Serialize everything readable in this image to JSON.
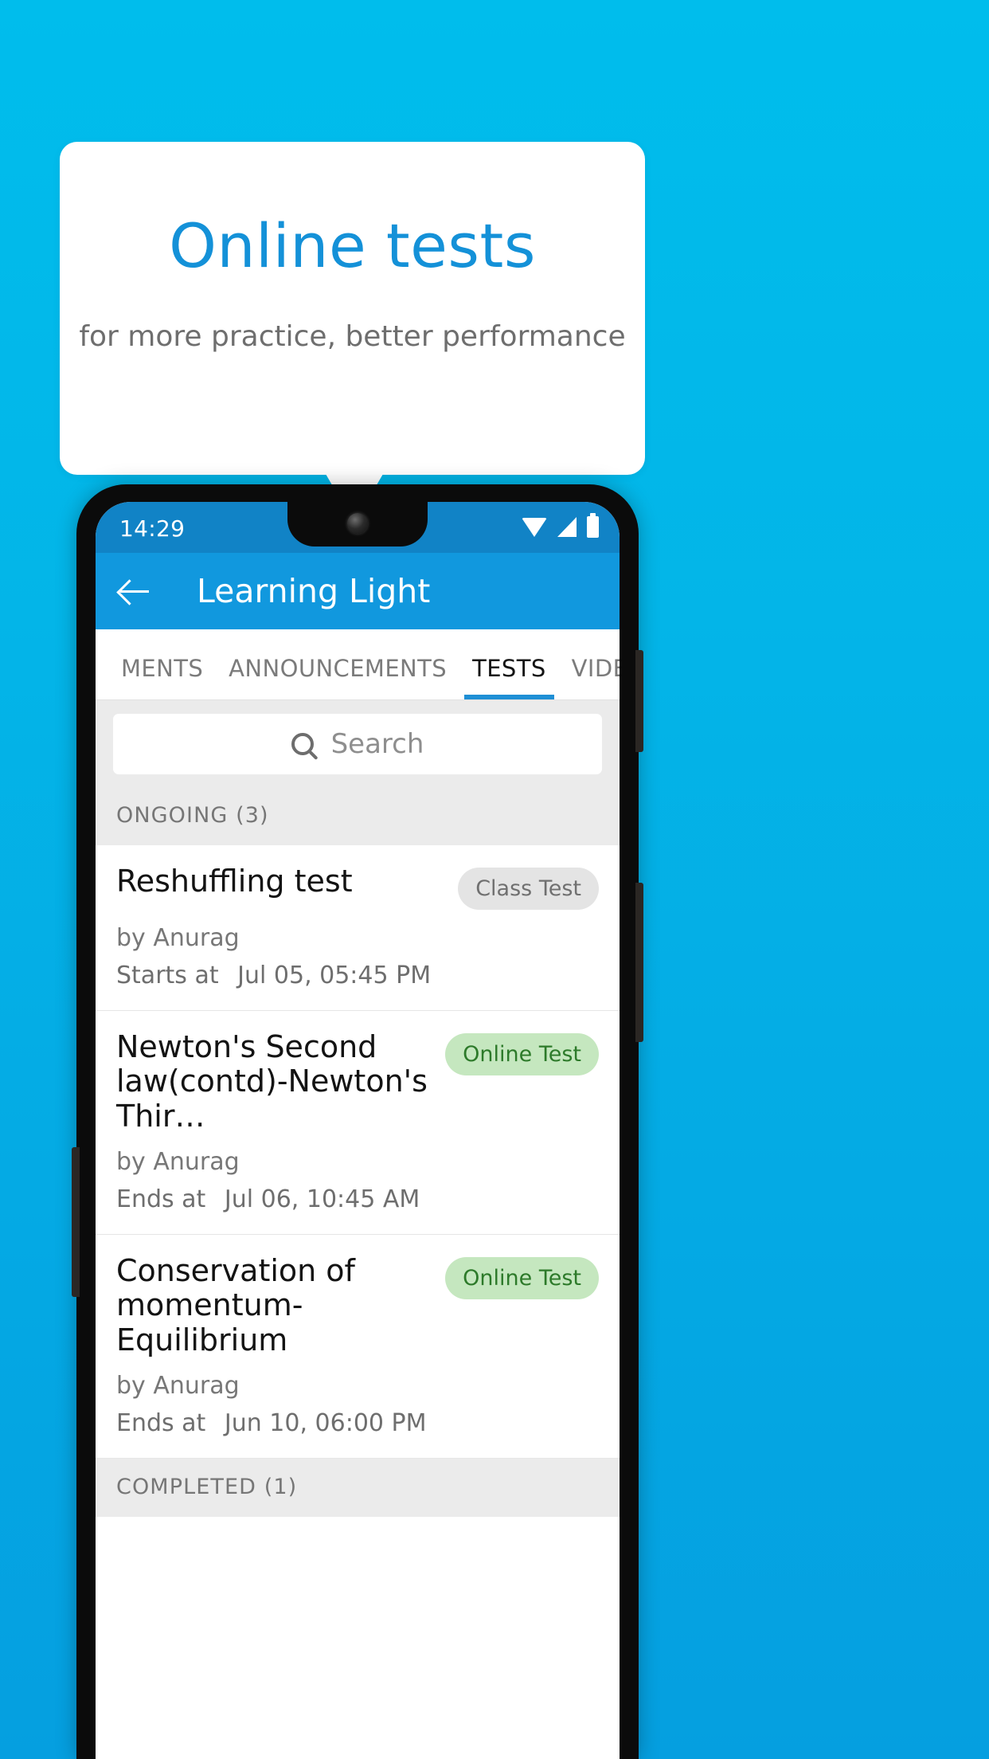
{
  "promo": {
    "title": "Online tests",
    "subtitle": "for more practice, better performance"
  },
  "colors": {
    "background_top": "#00BDEC",
    "background_bottom": "#059FE0",
    "promo_title": "#1491D8",
    "appbar": "#1198DE",
    "statusbar": "#1183C6",
    "tab_indicator": "#1E8FD5",
    "badge_gray_bg": "#E4E4E4",
    "badge_gray_text": "#707070",
    "badge_green_bg": "#C5E7BF",
    "badge_green_text": "#2D7A2A"
  },
  "phone": {
    "statusbar": {
      "time": "14:29",
      "icons": [
        "wifi-icon",
        "signal-icon",
        "battery-icon"
      ]
    },
    "appbar": {
      "back_icon": "back-arrow-icon",
      "title": "Learning Light"
    },
    "tabs": [
      {
        "label": "MENTS",
        "active": false
      },
      {
        "label": "ANNOUNCEMENTS",
        "active": false
      },
      {
        "label": "TESTS",
        "active": true
      },
      {
        "label": "VIDEOS",
        "active": false
      }
    ],
    "search": {
      "icon": "search-icon",
      "placeholder": "Search",
      "value": ""
    },
    "sections": [
      {
        "header": "ONGOING (3)",
        "items": [
          {
            "title": "Reshuffling test",
            "badge": "Class Test",
            "badge_style": "gray",
            "author": "by Anurag",
            "when_label": "Starts at",
            "when_value": "Jul 05, 05:45 PM"
          },
          {
            "title": "Newton's Second law(contd)-Newton's Thir…",
            "badge": "Online Test",
            "badge_style": "green",
            "author": "by Anurag",
            "when_label": "Ends at",
            "when_value": "Jul 06, 10:45 AM"
          },
          {
            "title": "Conservation of momentum-Equilibrium",
            "badge": "Online Test",
            "badge_style": "green",
            "author": "by Anurag",
            "when_label": "Ends at",
            "when_value": "Jun 10, 06:00 PM"
          }
        ]
      },
      {
        "header": "COMPLETED (1)",
        "items": []
      }
    ]
  }
}
